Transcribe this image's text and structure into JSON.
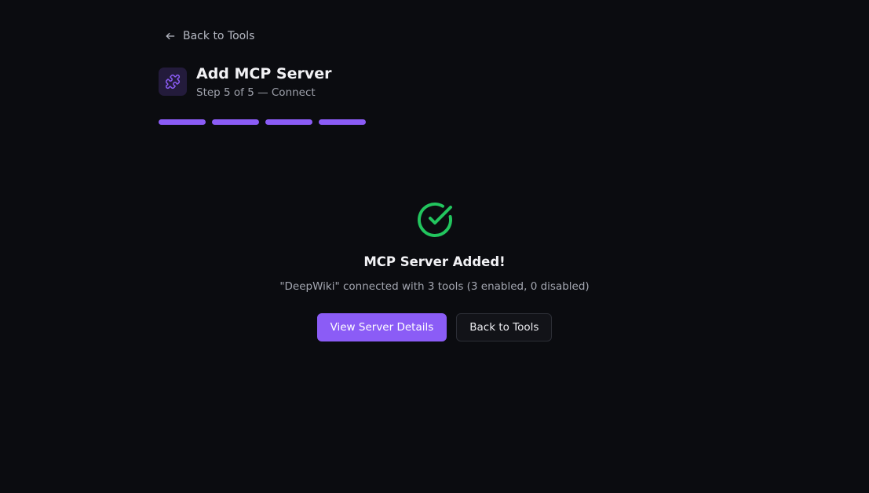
{
  "nav": {
    "back_label": "Back to Tools"
  },
  "header": {
    "title": "Add MCP Server",
    "subtitle": "Step 5 of 5 — Connect",
    "icon": "puzzle-icon"
  },
  "progress": {
    "current_step": 5,
    "total_steps": 5
  },
  "result": {
    "icon": "check-circle-icon",
    "title": "MCP Server Added!",
    "message": "\"DeepWiki\" connected with 3 tools (3 enabled, 0 disabled)"
  },
  "actions": {
    "primary_label": "View Server Details",
    "secondary_label": "Back to Tools"
  },
  "colors": {
    "background": "#0b0c10",
    "accent": "#8b5cf6",
    "success": "#22c55e"
  }
}
